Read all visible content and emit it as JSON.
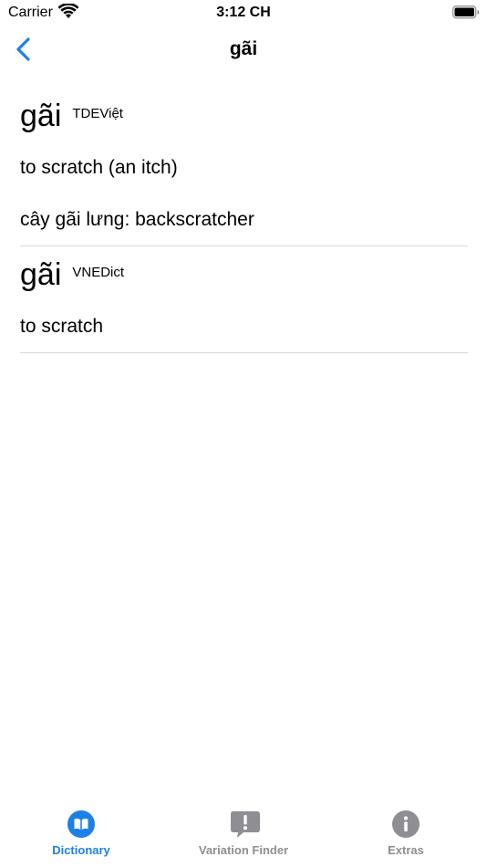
{
  "status_bar": {
    "carrier": "Carrier",
    "time": "3:12 CH",
    "wifi_icon": "wifi-icon",
    "battery_icon": "battery-icon"
  },
  "nav": {
    "title": "gãi",
    "back_icon": "chevron-left-icon"
  },
  "entries": [
    {
      "headword": "gãi",
      "source": "TDEViệt",
      "definitions": [
        "to scratch (an itch)",
        "cây gãi lưng: backscratcher"
      ]
    },
    {
      "headword": "gãi",
      "source": "VNEDict",
      "definitions": [
        "to scratch"
      ]
    }
  ],
  "tabs": [
    {
      "label": "Dictionary",
      "icon": "book-icon",
      "active": true
    },
    {
      "label": "Variation Finder",
      "icon": "exclamation-bubble-icon",
      "active": false
    },
    {
      "label": "Extras",
      "icon": "info-icon",
      "active": false
    }
  ],
  "colors": {
    "accent": "#1d80e6",
    "inactive": "#8e8e93",
    "separator": "#d8d8dc"
  }
}
